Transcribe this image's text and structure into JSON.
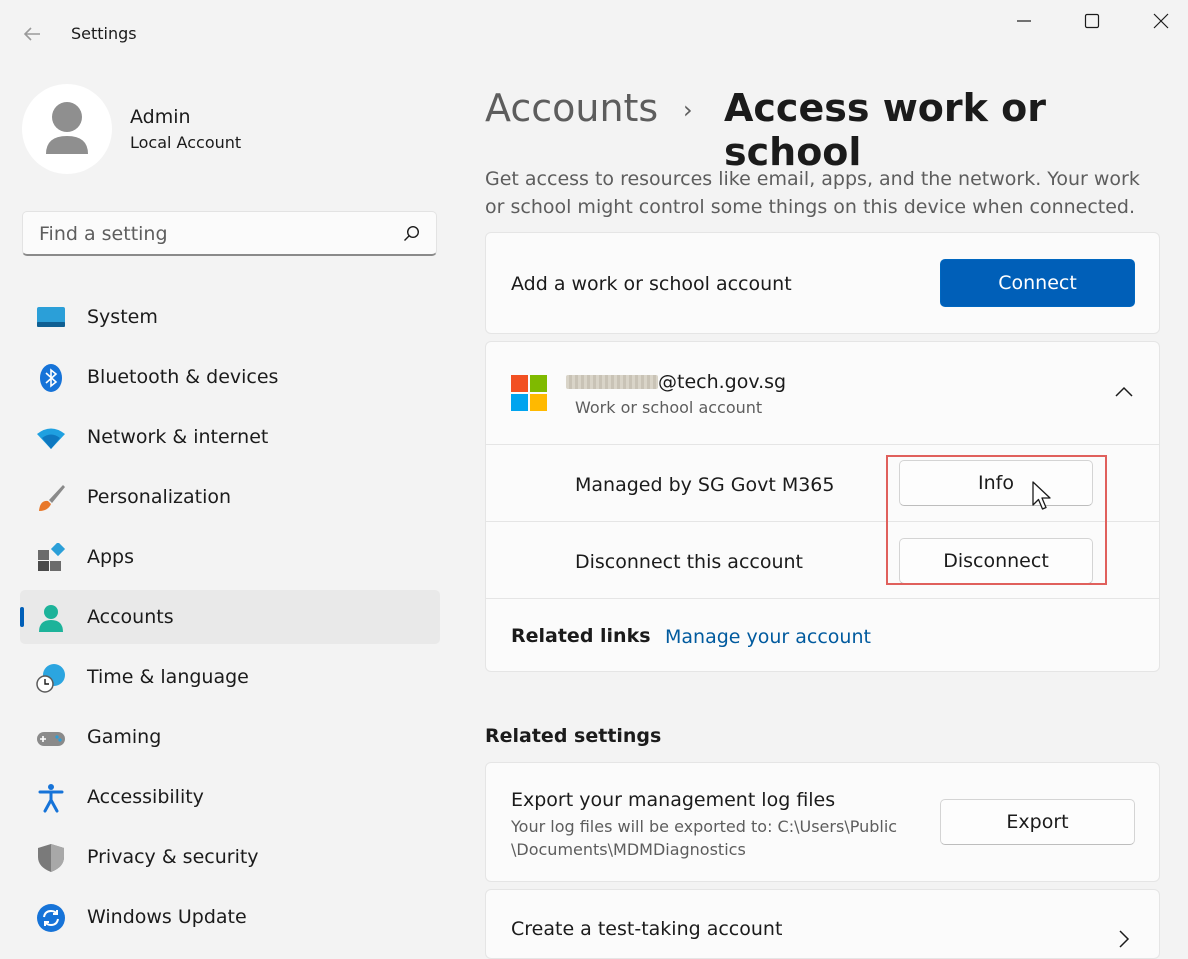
{
  "window": {
    "title": "Settings"
  },
  "profile": {
    "name": "Admin",
    "account_type": "Local Account"
  },
  "search": {
    "placeholder": "Find a setting"
  },
  "nav": {
    "items": [
      {
        "label": "System",
        "icon": "system-icon"
      },
      {
        "label": "Bluetooth & devices",
        "icon": "bluetooth-icon"
      },
      {
        "label": "Network & internet",
        "icon": "wifi-icon"
      },
      {
        "label": "Personalization",
        "icon": "brush-icon"
      },
      {
        "label": "Apps",
        "icon": "apps-icon"
      },
      {
        "label": "Accounts",
        "icon": "accounts-icon",
        "selected": true
      },
      {
        "label": "Time & language",
        "icon": "time-language-icon"
      },
      {
        "label": "Gaming",
        "icon": "gamepad-icon"
      },
      {
        "label": "Accessibility",
        "icon": "accessibility-icon"
      },
      {
        "label": "Privacy & security",
        "icon": "shield-icon"
      },
      {
        "label": "Windows Update",
        "icon": "update-icon"
      }
    ]
  },
  "header": {
    "breadcrumb_parent": "Accounts",
    "breadcrumb_separator": "›",
    "title": "Access work or school",
    "description": "Get access to resources like email, apps, and the network. Your work or school might control some things on this device when connected."
  },
  "add_account": {
    "label": "Add a work or school account",
    "button": "Connect"
  },
  "work_account": {
    "email_suffix": "@tech.gov.sg",
    "type": "Work or school account",
    "managed_by": "Managed by SG Govt M365",
    "info_button": "Info",
    "disconnect_label": "Disconnect this account",
    "disconnect_button": "Disconnect",
    "related_links_label": "Related links",
    "manage_link": "Manage your account"
  },
  "related_settings": {
    "heading": "Related settings",
    "export_title": "Export your management log files",
    "export_desc_line1": "Your log files will be exported to: C:\\Users\\Public",
    "export_desc_line2": "\\Documents\\MDMDiagnostics",
    "export_button": "Export",
    "test_account_title": "Create a test-taking account"
  },
  "colors": {
    "accent": "#005fb8",
    "highlight_box": "#e0605c",
    "link": "#005a9e"
  }
}
